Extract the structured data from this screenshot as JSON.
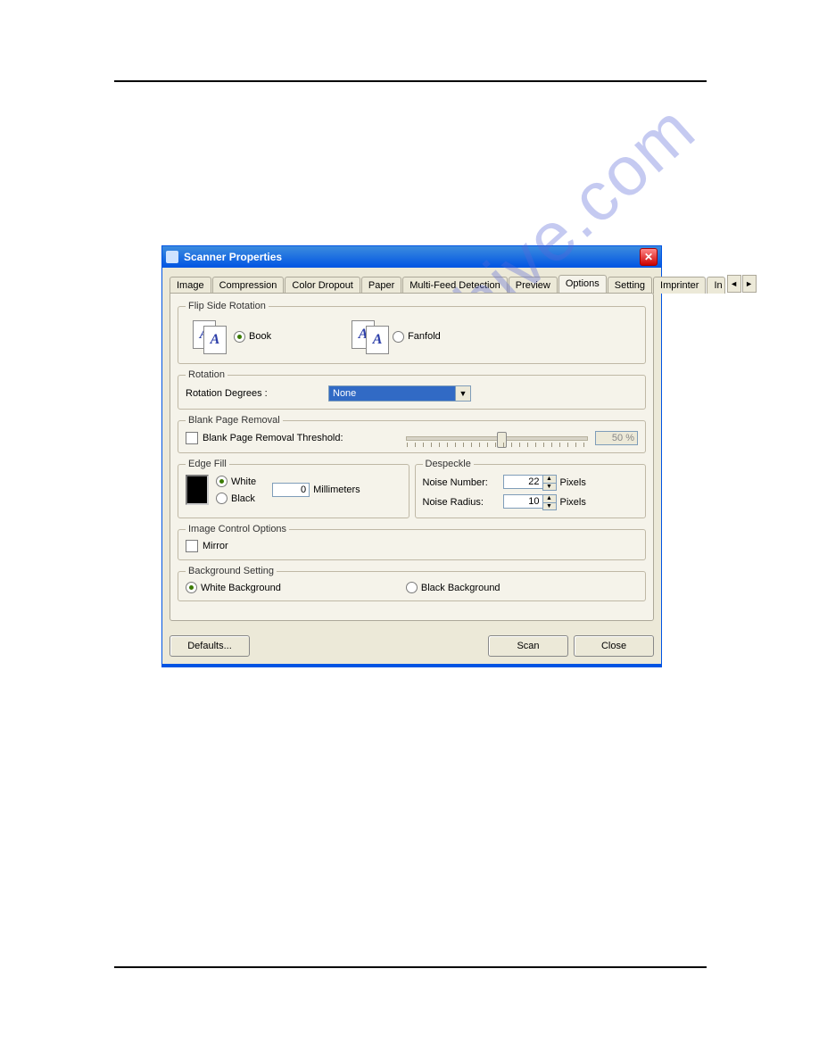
{
  "window": {
    "title": "Scanner Properties"
  },
  "tabs": {
    "items": [
      "Image",
      "Compression",
      "Color Dropout",
      "Paper",
      "Multi-Feed Detection",
      "Preview",
      "Options",
      "Setting",
      "Imprinter",
      "In"
    ],
    "active": "Options"
  },
  "flip_side": {
    "legend": "Flip Side Rotation",
    "book": "Book",
    "fanfold": "Fanfold",
    "selected": "book"
  },
  "rotation": {
    "legend": "Rotation",
    "label": "Rotation Degrees :",
    "value": "None"
  },
  "blank_page": {
    "legend": "Blank Page Removal",
    "check_label": "Blank Page Removal Threshold:",
    "checked": false,
    "percent": "50 %"
  },
  "edge_fill": {
    "legend": "Edge Fill",
    "white": "White",
    "black": "Black",
    "selected": "white",
    "value": "0",
    "unit": "Millimeters"
  },
  "despeckle": {
    "legend": "Despeckle",
    "noise_number_label": "Noise Number:",
    "noise_number": "22",
    "noise_radius_label": "Noise Radius:",
    "noise_radius": "10",
    "unit": "Pixels"
  },
  "image_control": {
    "legend": "Image Control Options",
    "mirror": "Mirror",
    "mirror_checked": false
  },
  "background": {
    "legend": "Background Setting",
    "white": "White Background",
    "black": "Black Background",
    "selected": "white"
  },
  "buttons": {
    "defaults": "Defaults...",
    "scan": "Scan",
    "close": "Close"
  },
  "watermark": "manualshive.com"
}
